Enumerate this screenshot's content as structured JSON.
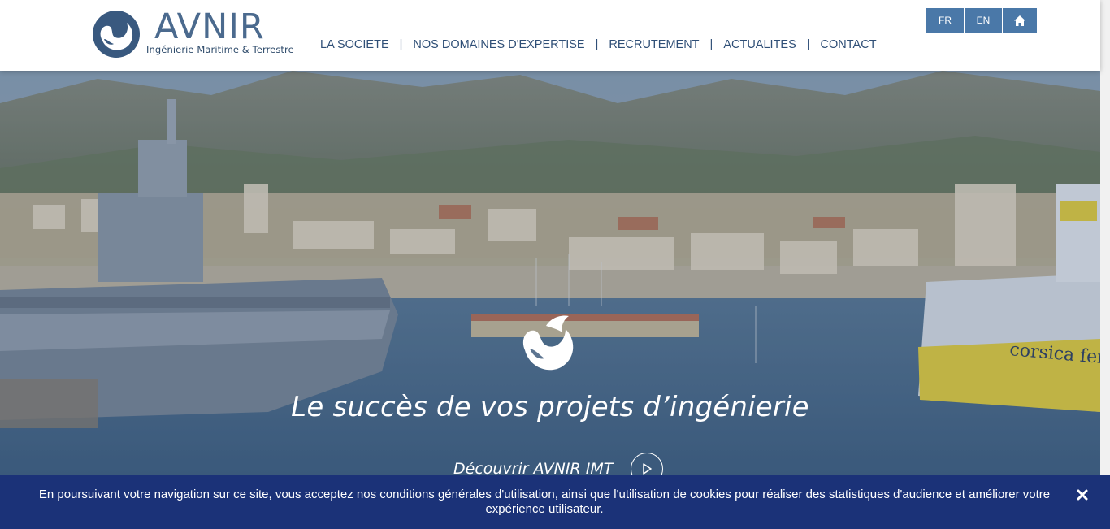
{
  "brand": {
    "name": "AVNIR",
    "tagline": "Ingénierie Maritime & Terrestre",
    "color": "#2f4f77"
  },
  "nav": {
    "items": [
      {
        "label": "LA SOCIETE"
      },
      {
        "label": "NOS DOMAINES D'EXPERTISE"
      },
      {
        "label": "RECRUTEMENT"
      },
      {
        "label": "ACTUALITES"
      },
      {
        "label": "CONTACT"
      }
    ],
    "separator": "|"
  },
  "lang": {
    "fr": "FR",
    "en": "EN",
    "home_icon": "home-icon"
  },
  "hero": {
    "title": "Le succès de vos projets d’ingénierie",
    "cta_label": "Découvrir AVNIR IMT",
    "cta_icon": "play-icon",
    "background": "harbor-photo",
    "ship_text": "corsica ferri"
  },
  "cookie": {
    "text": "En poursuivant votre navigation sur ce site, vous acceptez nos conditions générales d'utilisation, ainsi que l'utilisation de cookies pour réaliser des statistiques d'audience et améliorer votre expérience utilisateur.",
    "close_icon": "close-icon",
    "color": "#1b3278"
  }
}
